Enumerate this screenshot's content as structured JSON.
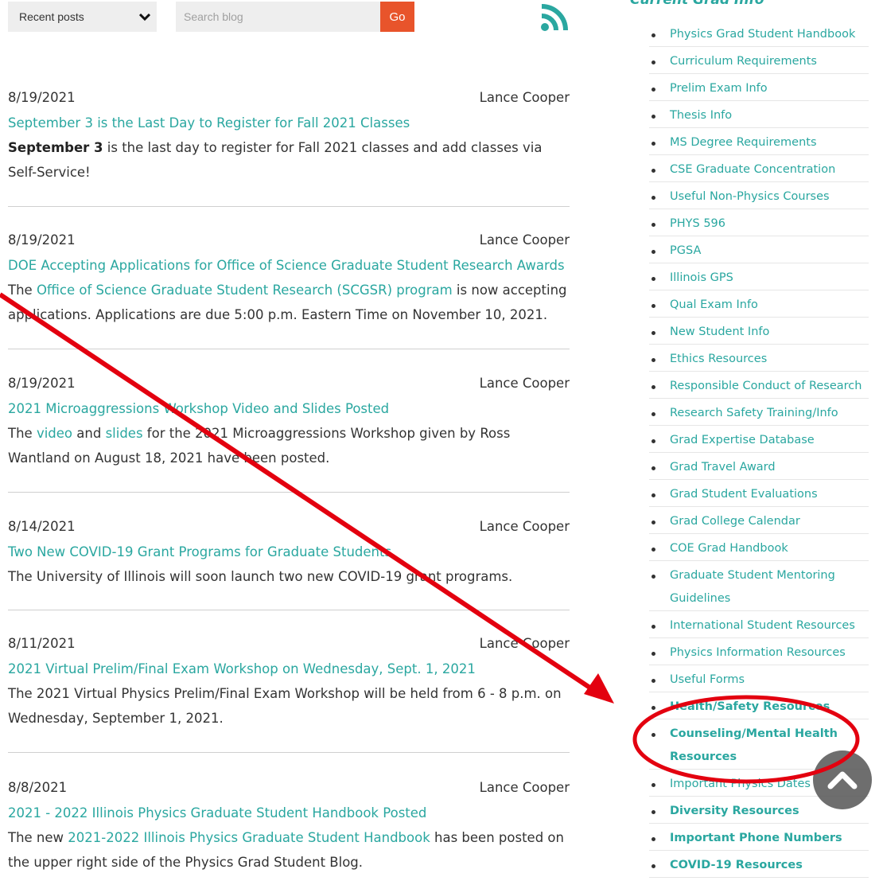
{
  "toolbar": {
    "select_value": "Recent posts",
    "search_placeholder": "Search blog",
    "go_label": "Go"
  },
  "posts": [
    {
      "date": "8/19/2021",
      "author": "Lance Cooper",
      "title": "September 3 is the Last Day to Register for Fall 2021 Classes",
      "summary_bold": "September 3",
      "summary_rest": " is the last day to register for Fall 2021 classes and add classes via Self-Service!"
    },
    {
      "date": "8/19/2021",
      "author": "Lance Cooper",
      "title": "DOE Accepting Applications for Office of Science Graduate Student Research Awards",
      "summary_pre": "The ",
      "summary_link": "Office of Science Graduate Student Research (SCGSR) program",
      "summary_post": " is now accepting applications. Applications are due 5:00 p.m. Eastern Time on November 10, 2021."
    },
    {
      "date": "8/19/2021",
      "author": "Lance Cooper",
      "title": "2021 Microaggressions Workshop Video and Slides Posted",
      "summary_pre": "The ",
      "summary_link1": "video",
      "summary_mid": " and ",
      "summary_link2": "slides",
      "summary_post": " for the 2021 Microaggressions Workshop given by Ross Wantland on August 18, 2021 have been posted."
    },
    {
      "date": "8/14/2021",
      "author": "Lance Cooper",
      "title": "Two New COVID-19 Grant Programs for Graduate Students",
      "summary": "The University of Illinois will soon launch two new COVID-19 grant programs."
    },
    {
      "date": "8/11/2021",
      "author": "Lance Cooper",
      "title": "2021 Virtual Prelim/Final Exam Workshop on Wednesday, Sept. 1, 2021",
      "summary": "The 2021 Virtual Physics Prelim/Final Exam Workshop will be held from 6 - 8 p.m. on Wednesday, September 1, 2021."
    },
    {
      "date": "8/8/2021",
      "author": "Lance Cooper",
      "title": "2021 - 2022 Illinois Physics Graduate Student Handbook Posted",
      "summary_pre": "The new ",
      "summary_link": "2021-2022 Illinois Physics Graduate Student Handbook",
      "summary_post": " has been posted on the upper right side of the Physics Grad Student Blog."
    }
  ],
  "sidebar": {
    "heading": "Current Grad Info",
    "items": [
      {
        "label": "Physics Grad Student Handbook"
      },
      {
        "label": "Curriculum Requirements"
      },
      {
        "label": "Prelim Exam Info"
      },
      {
        "label": "Thesis Info"
      },
      {
        "label": "MS Degree Requirements"
      },
      {
        "label": "CSE Graduate Concentration"
      },
      {
        "label": "Useful Non-Physics Courses"
      },
      {
        "label": "PHYS 596"
      },
      {
        "label": "PGSA"
      },
      {
        "label": "Illinois GPS"
      },
      {
        "label": "Qual Exam Info"
      },
      {
        "label": "New Student Info"
      },
      {
        "label": "Ethics Resources"
      },
      {
        "label": "Responsible Conduct of Research"
      },
      {
        "label": "Research Safety Training/Info"
      },
      {
        "label": "Grad Expertise Database"
      },
      {
        "label": "Grad Travel Award"
      },
      {
        "label": "Grad Student Evaluations"
      },
      {
        "label": "Grad College Calendar"
      },
      {
        "label": "COE Grad Handbook"
      },
      {
        "label": "Graduate Student Mentoring Guidelines"
      },
      {
        "label": "International Student Resources"
      },
      {
        "label": "Physics Information Resources"
      },
      {
        "label": "Useful Forms"
      },
      {
        "label": "Health/Safety Resources"
      },
      {
        "label": "Counseling/Mental Health Resources"
      },
      {
        "label": "Important Physics Dates"
      },
      {
        "label": "Diversity Resources"
      },
      {
        "label": "Important Phone Numbers"
      },
      {
        "label": "COVID-19 Resources"
      }
    ]
  },
  "colors": {
    "link": "#2aa7a0",
    "go_button": "#e8542b",
    "annotation": "#e3000f",
    "rss": "#2aa7a0"
  },
  "icons": [
    "chevron-down-icon",
    "rss-icon",
    "chevron-up-icon"
  ]
}
